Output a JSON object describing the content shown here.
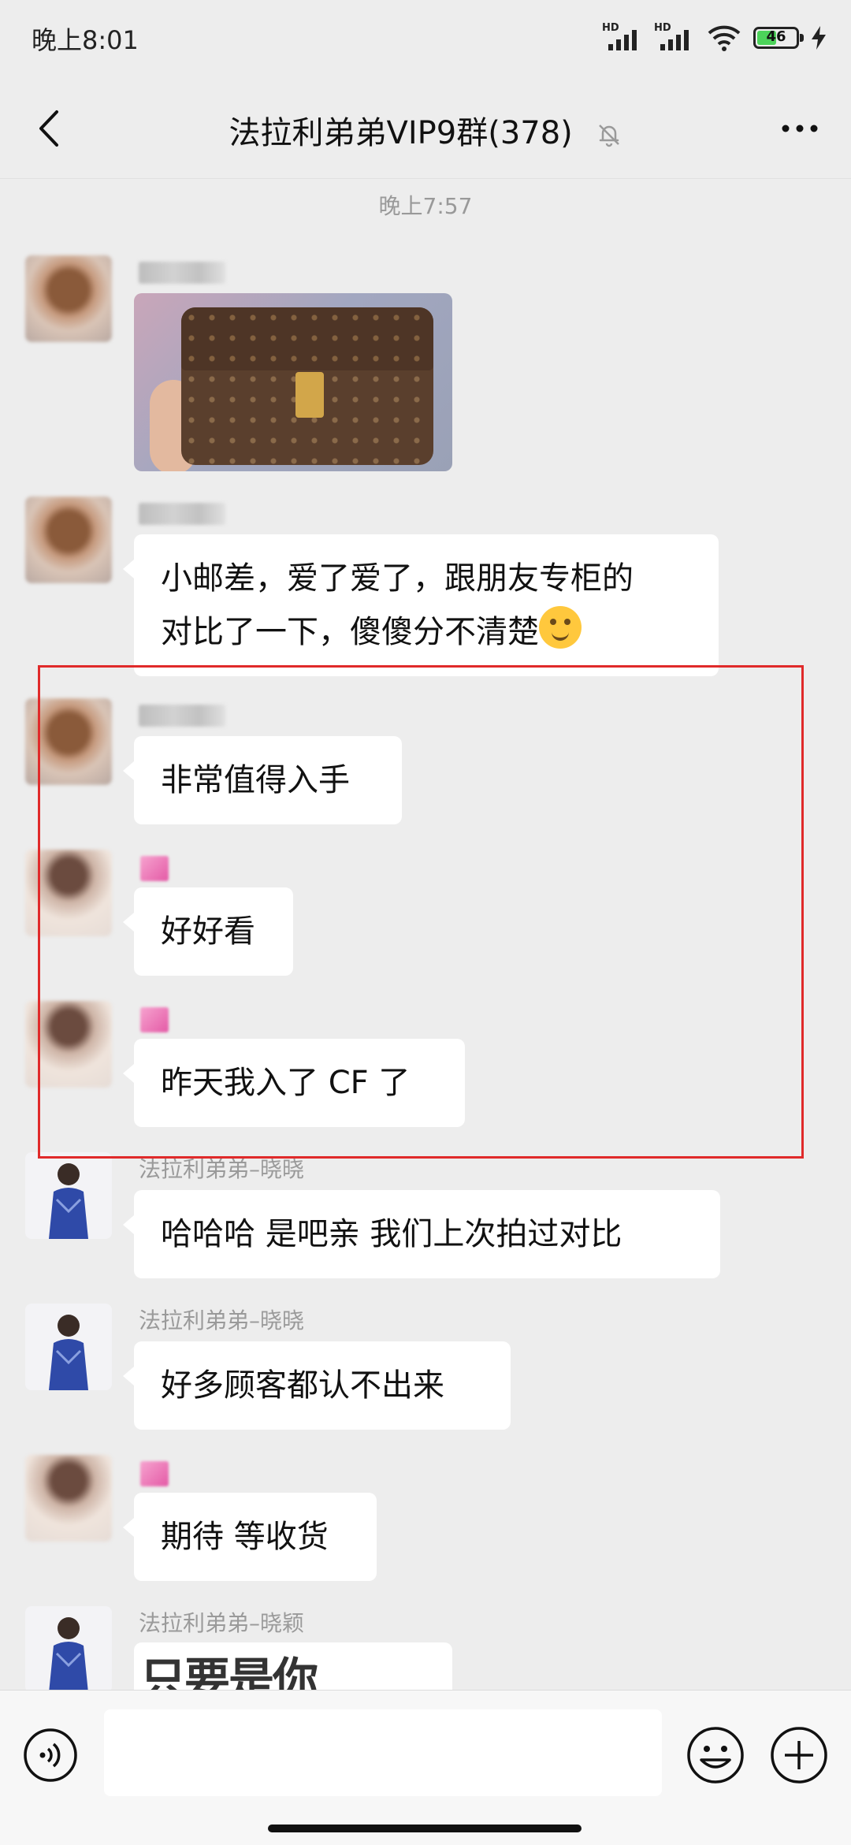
{
  "status_bar": {
    "time": "晚上8:01",
    "hd_label": "HD",
    "battery_level": "46"
  },
  "nav": {
    "title": "法拉利弟弟VIP9群(378)"
  },
  "chat": {
    "time_divider": "晚上7:57",
    "messages": [
      {
        "text": "小邮差，爱了爱了，跟朋友专柜的"
      },
      {
        "text": "对比了一下，傻傻分不清楚"
      },
      {
        "text": "非常值得入手"
      },
      {
        "text": "好好看"
      },
      {
        "text": "昨天我入了 CF 了"
      },
      {
        "sender": "法拉利弟弟–晓晓",
        "text": "哈哈哈 是吧亲 我们上次拍过对比"
      },
      {
        "sender": "法拉利弟弟–晓晓",
        "text": "好多顾客都认不出来"
      },
      {
        "text": "期待 等收货"
      },
      {
        "sender": "法拉利弟弟–晓颖",
        "image_text": "只要是你"
      }
    ]
  },
  "colors": {
    "background": "#ededed",
    "bubble": "#ffffff",
    "highlight_border": "#e02a2a",
    "battery_fill": "#4cd35a"
  }
}
